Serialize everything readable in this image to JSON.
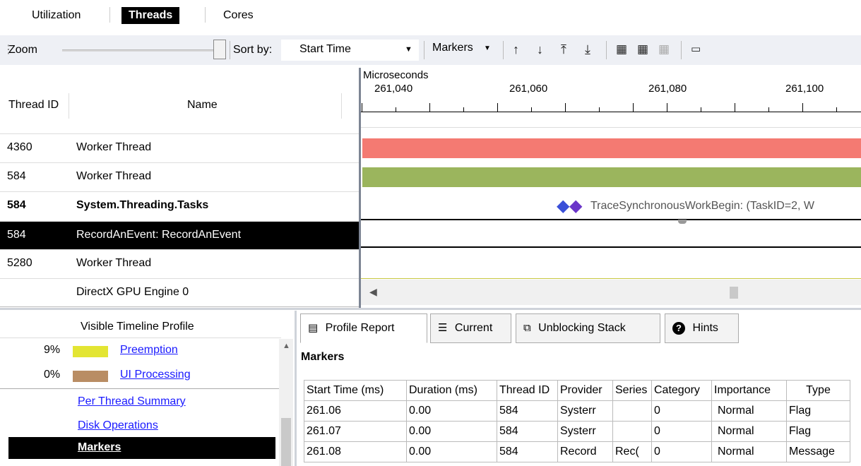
{
  "top_tabs": [
    {
      "label": "Utilization"
    },
    {
      "label": "Threads"
    },
    {
      "label": "Cores"
    }
  ],
  "toolbar": {
    "zoom_label": "Zoom",
    "sort_by_label": "Sort by:",
    "sort_value": "Start Time",
    "markers_label": "Markers"
  },
  "columns": {
    "thread_id": "Thread ID",
    "name": "Name",
    "units": "Microseconds"
  },
  "ticks": [
    "261,040",
    "261,060",
    "261,080",
    "261,100"
  ],
  "threads": [
    {
      "id": "4360",
      "name": "Worker Thread",
      "color": "#f47a72"
    },
    {
      "id": "584",
      "name": "Worker Thread",
      "color": "#9bb55d"
    },
    {
      "id": "584",
      "name": "System.Threading.Tasks",
      "marker_text": "TraceSynchronousWorkBegin: (TaskID=2, W"
    },
    {
      "id": "584",
      "name": "RecordAnEvent: RecordAnEvent"
    },
    {
      "id": "5280",
      "name": "Worker Thread"
    },
    {
      "id": "",
      "name": "DirectX GPU Engine 0"
    }
  ],
  "profile": {
    "title": "Visible Timeline Profile",
    "categories": [
      {
        "pct": "9%",
        "label": "Preemption",
        "color": "#e3e533"
      },
      {
        "pct": "0%",
        "label": "UI Processing",
        "color": "#b98d64"
      }
    ],
    "links": [
      "Per Thread Summary",
      "Disk Operations",
      "Markers"
    ]
  },
  "bottom_tabs": [
    {
      "label": "Profile Report",
      "icon": "report-icon"
    },
    {
      "label": "Current",
      "icon": "current-icon"
    },
    {
      "label": "Unblocking Stack",
      "icon": "stack-icon"
    },
    {
      "label": "Hints",
      "icon": "help-icon"
    }
  ],
  "markers_section": {
    "title": "Markers",
    "headers": [
      "Start Time (ms)",
      "Duration (ms)",
      "Thread ID",
      "Provider",
      "Series",
      "Category",
      "Importance",
      "Type"
    ],
    "rows": [
      [
        "261.06",
        "0.00",
        "584",
        "Systerr",
        "",
        "0",
        "Normal",
        "Flag"
      ],
      [
        "261.07",
        "0.00",
        "584",
        "Systerr",
        "",
        "0",
        "Normal",
        "Flag"
      ],
      [
        "261.08",
        "0.00",
        "584",
        "Record",
        "Rec(",
        "0",
        "Normal",
        "Message"
      ]
    ]
  }
}
